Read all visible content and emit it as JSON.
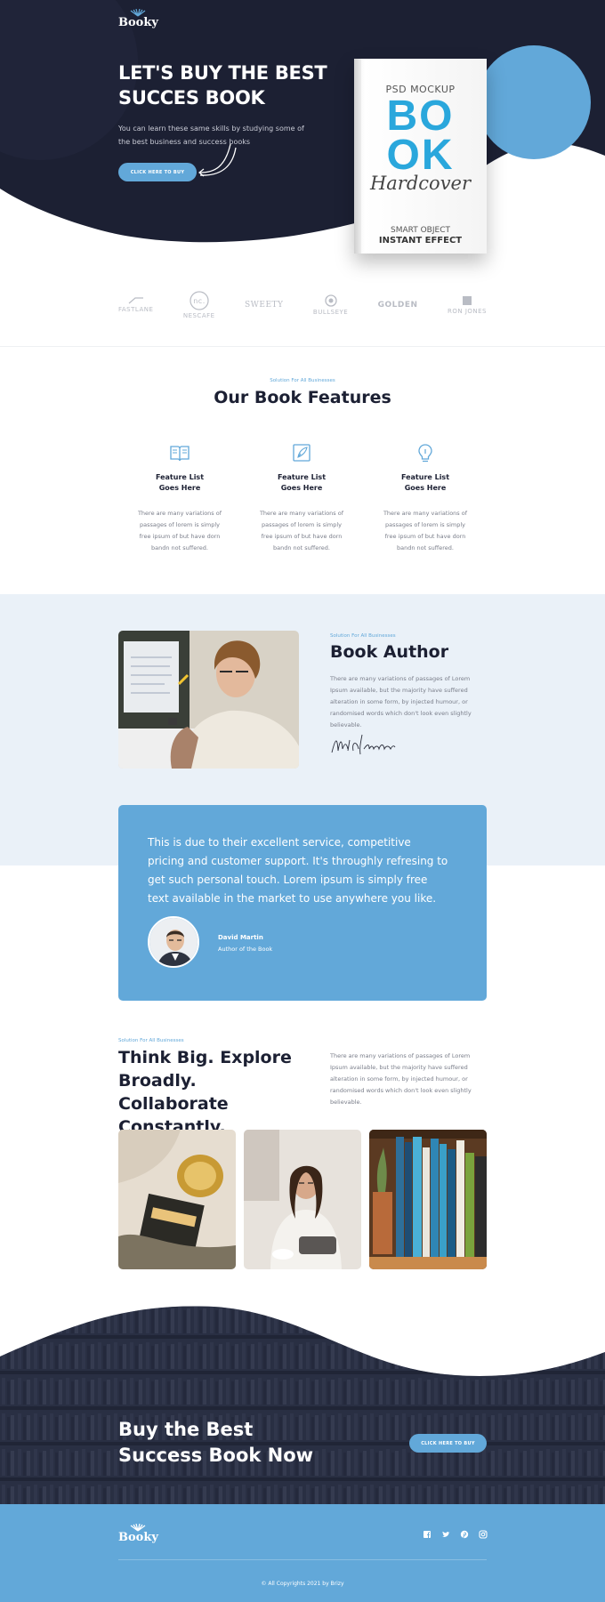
{
  "brand": {
    "name": "Booky"
  },
  "hero": {
    "title": "LET'S BUY THE BEST SUCCES BOOK",
    "text": "You can learn these same skills by studying some of the best business and success books",
    "button": "CLICK HERE TO BUY"
  },
  "book": {
    "subtitle": "PSD MOCKUP",
    "big_line1": "BO",
    "big_line2": "OK",
    "script": "Hardcover",
    "line1": "SMART OBJECT",
    "line2": "INSTANT EFFECT"
  },
  "brands": [
    "FASTLANE",
    "NESCAFE",
    "SWEETY",
    "BULLSEYE",
    "GOLDEN",
    "RON JONES"
  ],
  "features": {
    "eyebrow": "Solution For All Businesses",
    "title": "Our Book Features",
    "items": [
      {
        "title_line1": "Feature List",
        "title_line2": "Goes Here",
        "text": "There are many variations of passages of lorem is simply free ipsum of but have dorn bandn not suffered."
      },
      {
        "title_line1": "Feature List",
        "title_line2": "Goes Here",
        "text": "There are many variations of passages of lorem is simply free ipsum of but have dorn bandn not suffered."
      },
      {
        "title_line1": "Feature List",
        "title_line2": "Goes Here",
        "text": "There are many variations of passages of lorem is simply free ipsum of but have dorn bandn not suffered."
      }
    ]
  },
  "author": {
    "eyebrow": "Solution For All Businesses",
    "title": "Book Author",
    "text": "There are many variations of passages of Lorem Ipsum available, but the majority have suffered alteration in some form, by injected humour, or randomised words which don't look even slightly believable.",
    "signature": "Mike Hardson"
  },
  "testimonial": {
    "quote": "This is due to their excellent service, competitive pricing and customer support. It's throughly refresing to get such personal touch. Lorem ipsum is simply free text available in the market to use anywhere you like.",
    "name": "David Martin",
    "role": "Author of the Book"
  },
  "think": {
    "eyebrow": "Solution For All Businesses",
    "title": "Think Big. Explore Broadly. Collaborate Constantly.",
    "text": "There are many variations of passages of Lorem Ipsum available, but the majority have suffered alteration in some form, by injected humour, or randomised words which don't look even slightly believable."
  },
  "cta": {
    "title": "Buy the Best Success Book Now",
    "button": "CLICK HERE TO BUY"
  },
  "footer": {
    "social_icons": [
      "facebook-icon",
      "twitter-icon",
      "pinterest-icon",
      "instagram-icon"
    ],
    "copyright": "© All Copyrights 2021 by Brizy"
  },
  "colors": {
    "navy": "#1c2033",
    "accent": "#62a8d9",
    "light_bg": "#eaf1f8"
  }
}
